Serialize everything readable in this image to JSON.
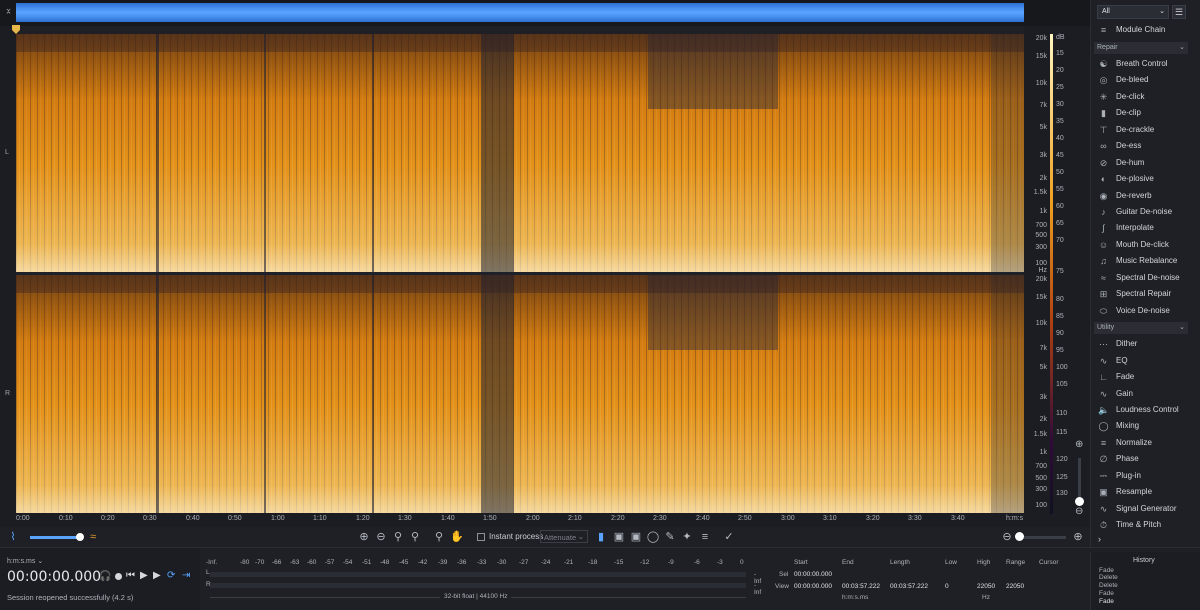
{
  "channels": {
    "left": "L",
    "right": "R"
  },
  "freq_ticks": [
    "20k",
    "15k",
    "10k",
    "7k",
    "5k",
    "3k",
    "2k",
    "1.5k",
    "1k",
    "700",
    "500",
    "300",
    "100",
    "Hz"
  ],
  "freq_ticks_r": [
    "20k",
    "15k",
    "10k",
    "7k",
    "5k",
    "3k",
    "2k",
    "1.5k",
    "1k",
    "700",
    "500",
    "300",
    "100"
  ],
  "db_ticks": [
    "dB",
    "15",
    "20",
    "25",
    "30",
    "35",
    "40",
    "45",
    "50",
    "55",
    "60",
    "65",
    "70",
    "75"
  ],
  "db_ticks_r": [
    "80",
    "85",
    "90",
    "95",
    "100",
    "105",
    "110",
    "115",
    "120",
    "125",
    "130"
  ],
  "time_ticks": [
    "0:00",
    "0:10",
    "0:20",
    "0:30",
    "0:40",
    "0:50",
    "1:00",
    "1:10",
    "1:20",
    "1:30",
    "1:40",
    "1:50",
    "2:00",
    "2:10",
    "2:20",
    "2:30",
    "2:40",
    "2:50",
    "3:00",
    "3:10",
    "3:20",
    "3:30",
    "3:40"
  ],
  "time_unit": "h:m:s",
  "toolbar": {
    "instant_process": "Instant process",
    "attenuate": "Attenuate"
  },
  "filter": {
    "value": "All"
  },
  "module_chain": "Module Chain",
  "sections": {
    "repair": "Repair",
    "utility": "Utility"
  },
  "repair_modules": [
    "Breath Control",
    "De-bleed",
    "De-click",
    "De-clip",
    "De-crackle",
    "De-ess",
    "De-hum",
    "De-plosive",
    "De-reverb",
    "Guitar De-noise",
    "Interpolate",
    "Mouth De-click",
    "Music Rebalance",
    "Spectral De-noise",
    "Spectral Repair",
    "Voice De-noise"
  ],
  "utility_modules": [
    "Dither",
    "EQ",
    "Fade",
    "Gain",
    "Loudness Control",
    "Mixing",
    "Normalize",
    "Phase",
    "Plug-in",
    "Resample",
    "Signal Generator",
    "Time & Pitch"
  ],
  "transport": {
    "format_label": "h:m:s.ms",
    "time": "00:00:00.000",
    "status": "Session reopened successfully (4.2 s)"
  },
  "meter": {
    "scale": [
      "-Inf.",
      "-80",
      "-70",
      "-66",
      "-63",
      "-60",
      "-57",
      "-54",
      "-51",
      "-48",
      "-45",
      "-42",
      "-39",
      "-36",
      "-33",
      "-30",
      "-27",
      "-24",
      "-21",
      "-18",
      "-15",
      "-12",
      "-9",
      "-6",
      "-3",
      "0"
    ],
    "left_ch": "L",
    "right_ch": "R",
    "inf_l": "-Inf",
    "inf_r": "-Inf",
    "format": "32-bit float | 44100 Hz"
  },
  "selection": {
    "headers": {
      "start": "Start",
      "end": "End",
      "length": "Length",
      "low": "Low",
      "high": "High",
      "range": "Range",
      "cursor": "Cursor"
    },
    "sel": {
      "label": "Sel",
      "start": "00:00:00.000",
      "end": "",
      "length": ""
    },
    "view": {
      "label": "View",
      "start": "00:00:00.000",
      "end": "00:03:57.222",
      "length": "00:03:57.222",
      "low": "0",
      "high": "22050",
      "range": "22050"
    },
    "unit_time": "h:m:s.ms",
    "unit_freq": "Hz"
  },
  "history": {
    "title": "History",
    "items": [
      "Fade",
      "Delete",
      "Delete",
      "Fade",
      "Fade"
    ]
  }
}
